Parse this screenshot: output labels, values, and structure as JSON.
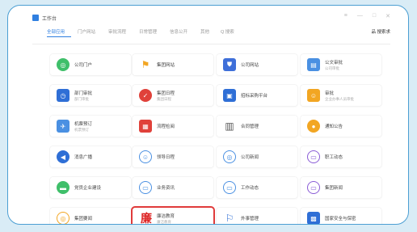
{
  "window": {
    "title": "工作台",
    "controls": [
      "≡",
      "—",
      "□",
      "✕"
    ]
  },
  "tabs": [
    {
      "label": "全部应用",
      "active": true
    },
    {
      "label": "门户网站",
      "active": false
    },
    {
      "label": "审批流程",
      "active": false
    },
    {
      "label": "日常管理",
      "active": false
    },
    {
      "label": "信息公开",
      "active": false
    },
    {
      "label": "其他",
      "active": false
    }
  ],
  "search": {
    "label": "Q 搜索"
  },
  "toolbar": {
    "more_label": "品 搜索求"
  },
  "apps": [
    {
      "label": "公司门户",
      "sub": "",
      "icon": "green-circle-icon",
      "color": "#3fbf6a",
      "shape": "circle",
      "glyph": "◎"
    },
    {
      "label": "集团网站",
      "sub": "",
      "icon": "flag-icon",
      "color": "#f2a623",
      "shape": "plain",
      "glyph": "⚑"
    },
    {
      "label": "公司网站",
      "sub": "",
      "icon": "shield-icon",
      "color": "#3e6fd9",
      "shape": "sq",
      "glyph": "⛊"
    },
    {
      "label": "公文审批",
      "sub": "公司审批",
      "icon": "document-icon",
      "color": "#4a90e2",
      "shape": "sq",
      "glyph": "▤"
    },
    {
      "label": "部门审批",
      "sub": "部门审批",
      "icon": "clock-icon",
      "color": "#2f6fd6",
      "shape": "sq",
      "glyph": "◷"
    },
    {
      "label": "集团日程",
      "sub": "集团日程",
      "icon": "check-circle-icon",
      "color": "#e0413a",
      "shape": "circle",
      "glyph": "✓"
    },
    {
      "label": "招标采购平台",
      "sub": "",
      "icon": "building-icon",
      "color": "#2f6fd6",
      "shape": "sq",
      "glyph": "▣"
    },
    {
      "label": "审批",
      "sub": "企业办事人员审批",
      "icon": "person-icon",
      "color": "#f2a623",
      "shape": "sq",
      "glyph": "☺"
    },
    {
      "label": "机票预订",
      "sub": "机票预订",
      "icon": "ticket-icon",
      "color": "#4a90e2",
      "shape": "sq",
      "glyph": "✈"
    },
    {
      "label": "流程检阅",
      "sub": "",
      "icon": "calendar-icon",
      "color": "#e0413a",
      "shape": "sq",
      "glyph": "▦"
    },
    {
      "label": "合同管理",
      "sub": "",
      "icon": "printer-icon",
      "color": "#555555",
      "shape": "plain",
      "glyph": "▥"
    },
    {
      "label": "通知公告",
      "sub": "",
      "icon": "chat-icon",
      "color": "#f2a623",
      "shape": "circle",
      "glyph": "●"
    },
    {
      "label": "消息广播",
      "sub": "",
      "icon": "broadcast-icon",
      "color": "#2f6fd6",
      "shape": "circle",
      "glyph": "◀"
    },
    {
      "label": "领导日程",
      "sub": "",
      "icon": "person-card-icon",
      "color": "#4a90e2",
      "shape": "circle-outline",
      "glyph": "☺"
    },
    {
      "label": "公司新闻",
      "sub": "",
      "icon": "news-icon",
      "color": "#4a90e2",
      "shape": "circle-outline",
      "glyph": "◎"
    },
    {
      "label": "职工动态",
      "sub": "",
      "icon": "dynamic-icon",
      "color": "#8a5cd6",
      "shape": "circle-outline",
      "glyph": "▭"
    },
    {
      "label": "党员企业建设",
      "sub": "",
      "icon": "party-icon",
      "color": "#3fbf6a",
      "shape": "circle",
      "glyph": "▬"
    },
    {
      "label": "业务资讯",
      "sub": "",
      "icon": "info-icon",
      "color": "#4a90e2",
      "shape": "circle-outline",
      "glyph": "▭"
    },
    {
      "label": "工作动态",
      "sub": "",
      "icon": "work-icon",
      "color": "#4a90e2",
      "shape": "circle-outline",
      "glyph": "▭"
    },
    {
      "label": "集团新闻",
      "sub": "",
      "icon": "group-news-icon",
      "color": "#8a5cd6",
      "shape": "circle-outline",
      "glyph": "▭"
    },
    {
      "label": "集团要闻",
      "sub": "",
      "icon": "target-icon",
      "color": "#f2a623",
      "shape": "circle-outline",
      "glyph": "◎"
    },
    {
      "label": "廉洁教育",
      "sub": "廉洁教育",
      "icon": "lian-seal-icon",
      "color": "#dd2222",
      "shape": "kanji",
      "glyph": "廉",
      "highlighted": true
    },
    {
      "label": "外事管理",
      "sub": "",
      "icon": "flag-run-icon",
      "color": "#2f6fd6",
      "shape": "plain",
      "glyph": "⚐"
    },
    {
      "label": "国家安全与保密",
      "sub": "",
      "icon": "security-icon",
      "color": "#2f6fd6",
      "shape": "sq",
      "glyph": "▩"
    }
  ]
}
